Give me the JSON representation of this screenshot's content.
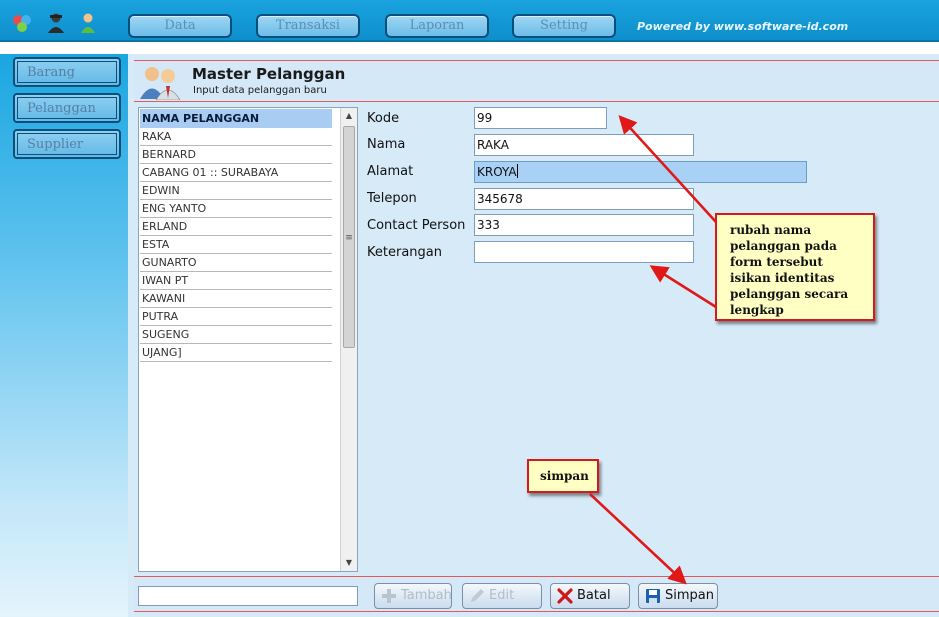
{
  "topbar": {
    "icons": [
      "user-group-icon",
      "agent-icon",
      "person-icon"
    ],
    "menu": [
      "Data",
      "Transaksi",
      "Laporan",
      "Setting"
    ],
    "powered_by": "Powered by www.software-id.com"
  },
  "sidebar": {
    "items": [
      "Barang",
      "Pelanggan",
      "Supplier"
    ]
  },
  "header": {
    "title": "Master Pelanggan",
    "subtitle": "Input data pelanggan baru"
  },
  "list": {
    "header": "NAMA PELANGGAN",
    "rows": [
      "RAKA",
      "BERNARD",
      "CABANG 01 :: SURABAYA",
      "EDWIN",
      "ENG YANTO",
      "ERLAND",
      "ESTA",
      "GUNARTO",
      "IWAN PT",
      "KAWANI",
      "PUTRA",
      "SUGENG",
      "UJANG]"
    ]
  },
  "form": {
    "kode_label": "Kode",
    "kode_value": "99",
    "nama_label": "Nama",
    "nama_value": "RAKA",
    "alamat_label": "Alamat",
    "alamat_value": "KROYA",
    "telepon_label": "Telepon",
    "telepon_value": "345678",
    "contact_label": "Contact Person",
    "contact_value": "333",
    "keterangan_label": "Keterangan",
    "keterangan_value": ""
  },
  "buttons": {
    "tambah": "Tambah",
    "edit": "Edit",
    "batal": "Batal",
    "simpan": "Simpan"
  },
  "annotations": {
    "note_main": "rubah nama pelanggan pada form tersebut isikan identitas pelanggan secara lengkap",
    "note_simpan": "simpan",
    "arrow_color": "#e01818"
  }
}
